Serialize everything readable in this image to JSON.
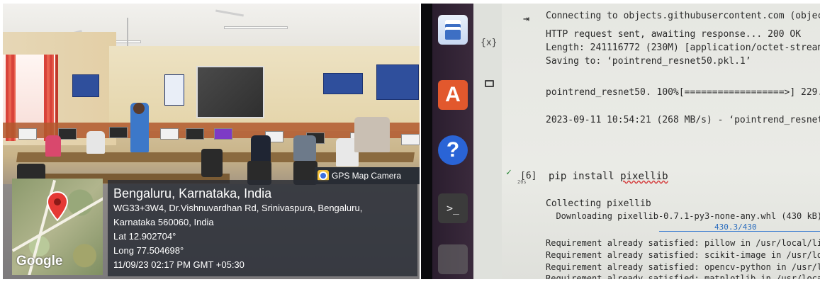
{
  "left_photo": {
    "gps_camera_label": "GPS Map Camera",
    "map_brand": "Google",
    "location_title": "Bengaluru, Karnataka, India",
    "address_line_1": "WG33+3W4, Dr.Vishnuvardhan Rd, Srinivaspura, Bengaluru,",
    "address_line_2": "Karnataka 560060, India",
    "latitude": "Lat 12.902704°",
    "longitude": "Long 77.504698°",
    "timestamp": "11/09/23 02:17 PM GMT +05:30"
  },
  "right_photo": {
    "dock_icons": [
      "document-viewer-icon",
      "app-store-icon",
      "help-icon",
      "terminal-icon",
      "blank-app-icon"
    ],
    "store_glyph": "A",
    "help_glyph": "?",
    "terminal_glyph": ">_",
    "sidebar": {
      "variables_glyph": "{x}",
      "folder_icon": "folder-icon"
    },
    "output_lines": [
      "Connecting to objects.githubusercontent.com (objec",
      "HTTP request sent, awaiting response... 200 OK",
      "Length: 241116772 (230M) [application/octet-stream]",
      "Saving to: ‘pointrend_resnet50.pkl.1’",
      "pointrend_resnet50. 100%[==================>] 229.9",
      "2023-09-11 10:54:21 (268 MB/s) - ‘pointrend_resnet50"
    ],
    "cell": {
      "status": "✓",
      "number": "[6]",
      "code_prefix": "pip install ",
      "code_word": "pixellib",
      "time": "20s"
    },
    "install_lines": [
      "Collecting pixellib",
      "  Downloading pixellib-0.7.1-py3-none-any.whl (430 kB)",
      "Requirement already satisfied: pillow in /usr/local/lib",
      "Requirement already satisfied: scikit-image in /usr/loc",
      "Requirement already satisfied: opencv-python in /usr/lo",
      "Requirement already satisfied: matplotlib in /usr/local"
    ],
    "progress_text": "430.3/430"
  }
}
